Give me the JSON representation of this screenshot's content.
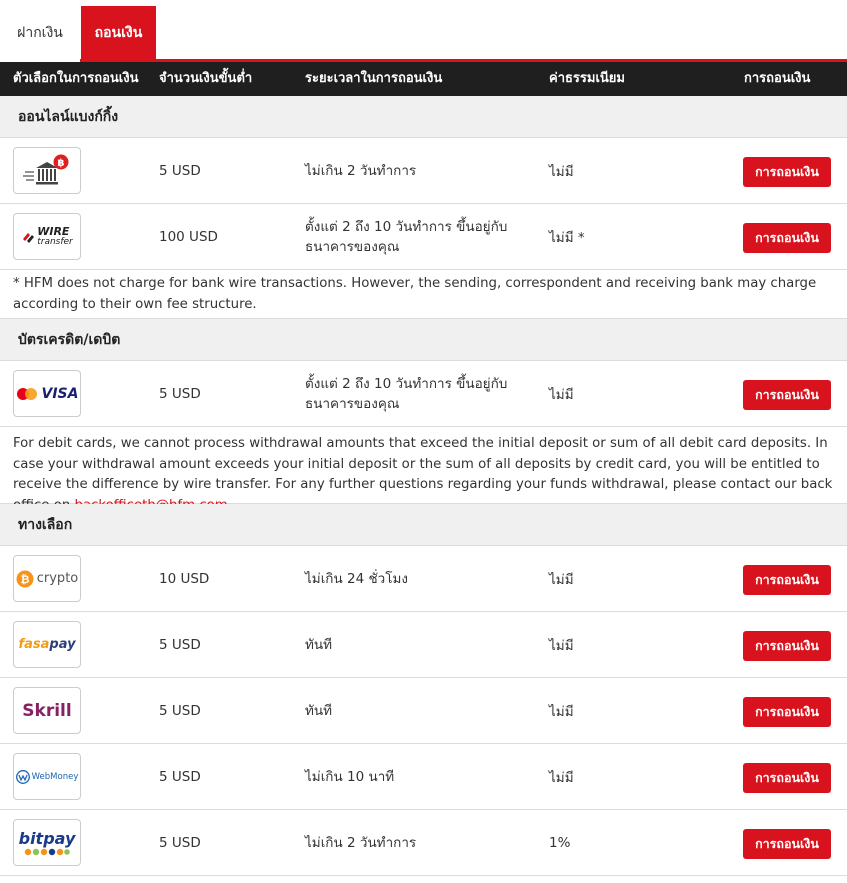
{
  "tabs": {
    "deposit": "ฝากเงิน",
    "withdraw": "ถอนเงิน"
  },
  "table_header": {
    "option": "ตัวเลือกในการถอนเงิน",
    "minimum": "จำนวนเงินขั้นต่ำ",
    "time": "ระยะเวลาในการถอนเงิน",
    "fee": "ค่าธรรมเนียม",
    "action": "การถอนเงิน"
  },
  "sections": {
    "online_banking": "ออนไลน์แบงก์กิ้ง",
    "cards": "บัตรเครดิต/เดบิต",
    "alternatives": "ทางเลือก"
  },
  "button_label": "การถอนเงิน",
  "rows": {
    "bank": {
      "logo": "bank-icon",
      "minimum": "5 USD",
      "time": "ไม่เกิน 2 วันทำการ",
      "fee": "ไม่มี"
    },
    "wire": {
      "logo": "wire-transfer-logo",
      "logo_text_1": "WIRE",
      "logo_text_2": "transfer",
      "minimum": "100 USD",
      "time": "ตั้งแต่ 2 ถึง 10 วันทำการ ขึ้นอยู่กับธนาคารของคุณ",
      "fee": "ไม่มี *"
    },
    "visa": {
      "logo": "mastercard-visa-logo",
      "logo_text": "VISA",
      "minimum": "5 USD",
      "time": "ตั้งแต่ 2 ถึง 10 วันทำการ ขึ้นอยู่กับธนาคารของคุณ",
      "fee": "ไม่มี"
    },
    "crypto": {
      "logo": "crypto-logo",
      "logo_text": "crypto",
      "minimum": "10 USD",
      "time": "ไม่เกิน 24 ชั่วโมง",
      "fee": "ไม่มี"
    },
    "fasapay": {
      "logo": "fasapay-logo",
      "logo_text_1": "fasa",
      "logo_text_2": "pay",
      "minimum": "5 USD",
      "time": "ทันที",
      "fee": "ไม่มี"
    },
    "skrill": {
      "logo": "skrill-logo",
      "logo_text": "Skrill",
      "minimum": "5 USD",
      "time": "ทันที",
      "fee": "ไม่มี"
    },
    "webmoney": {
      "logo": "webmoney-logo",
      "logo_text": "WebMoney",
      "minimum": "5 USD",
      "time": "ไม่เกิน 10 นาที",
      "fee": "ไม่มี"
    },
    "bitpay": {
      "logo": "bitpay-logo",
      "logo_text": "bitpay",
      "minimum": "5 USD",
      "time": "ไม่เกิน 2 วันทำการ",
      "fee": "1%"
    }
  },
  "notes": {
    "wire": "* HFM does not charge for bank wire transactions. However, the sending, correspondent and receiving bank may charge according to their own fee structure.",
    "cards": "For debit cards, we cannot process withdrawal amounts that exceed the initial deposit or sum of all debit card deposits. In case your withdrawal amount exceeds your initial deposit or the sum of all deposits by credit card, you will be entitled to receive the difference by wire transfer. For any further questions regarding your funds withdrawal, please contact our back office on",
    "cards_email": "backofficeth@hfm.com",
    "cards_end": "."
  },
  "colors": {
    "accent": "#d8131d",
    "header_bg": "#1f1f1f",
    "section_bg": "#f0f0f0"
  }
}
